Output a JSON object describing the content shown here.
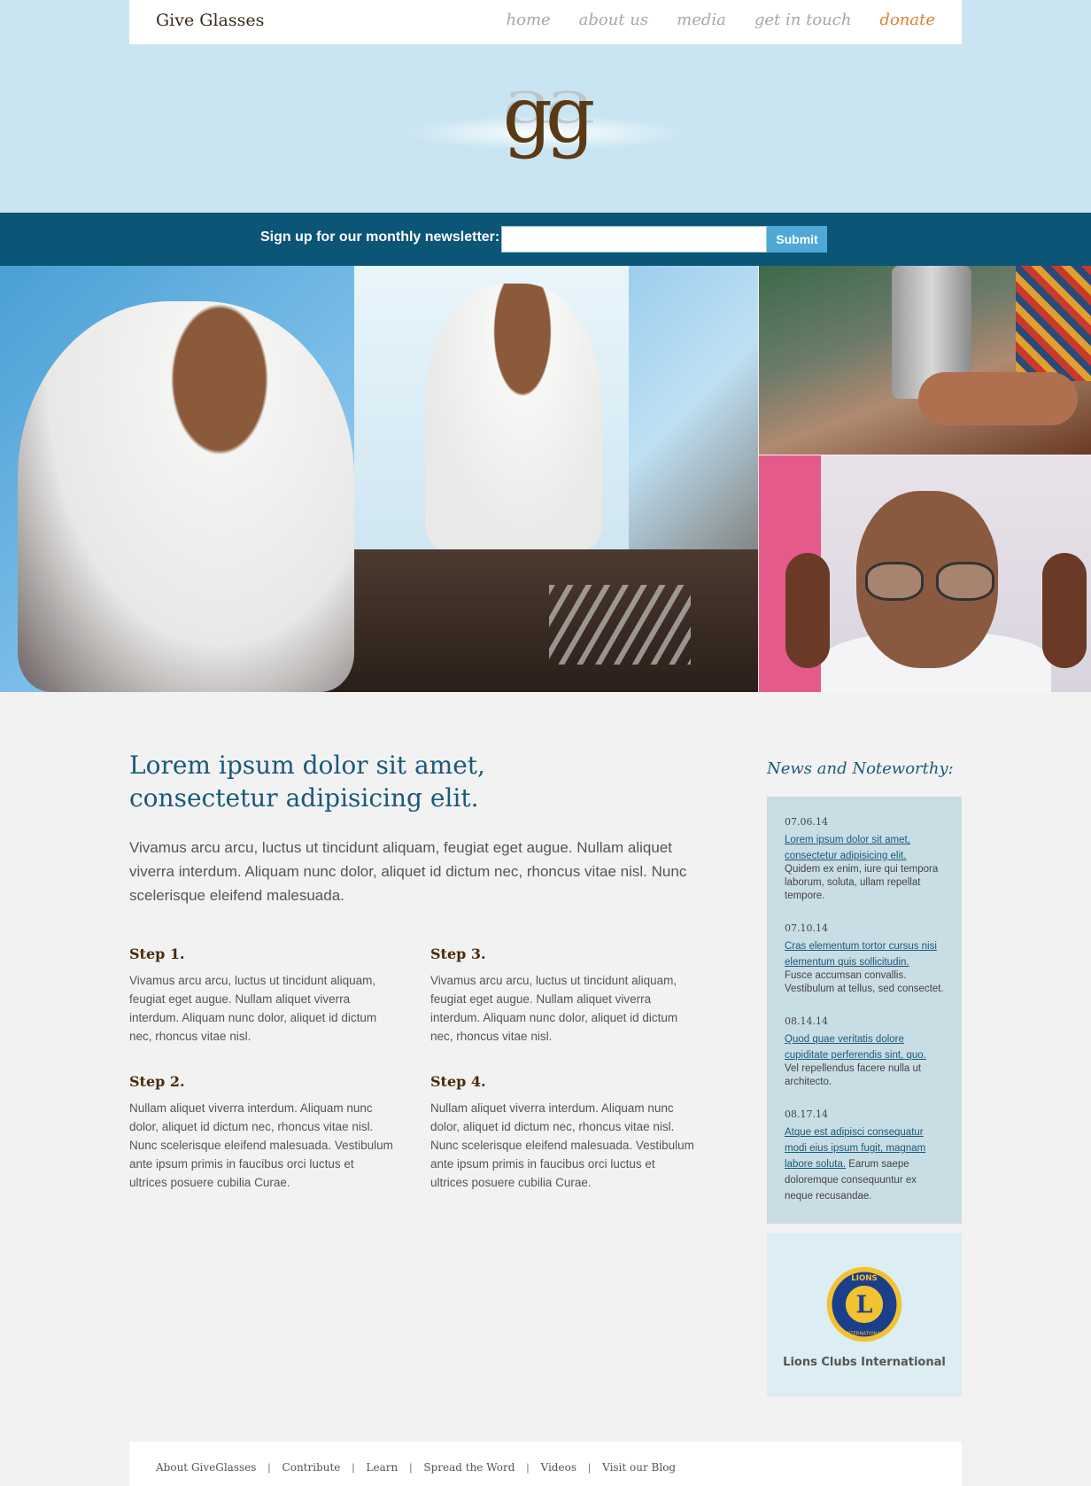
{
  "header": {
    "brand": "Give Glasses",
    "nav": [
      "home",
      "about us",
      "media",
      "get in touch",
      "donate"
    ],
    "logo_text": "gg"
  },
  "newsletter": {
    "label": "Sign up for our monthly newsletter:",
    "input_value": "",
    "submit": "Submit"
  },
  "main": {
    "headline_line1": "Lorem ipsum dolor sit amet,",
    "headline_line2": "consectetur adipisicing elit.",
    "lead": "Vivamus arcu arcu, luctus ut tincidunt aliquam, feugiat eget augue. Nullam aliquet viverra interdum. Aliquam nunc dolor, aliquet id dictum nec, rhoncus vitae nisl. Nunc scelerisque eleifend malesuada.",
    "steps": [
      {
        "title": "Step 1.",
        "text": "Vivamus arcu arcu, luctus ut tincidunt aliquam, feugiat eget augue. Nullam aliquet viverra interdum. Aliquam nunc dolor, aliquet id dictum nec, rhoncus vitae nisl."
      },
      {
        "title": "Step 2.",
        "text": "Nullam aliquet viverra interdum. Aliquam nunc dolor, aliquet id dictum nec, rhoncus vitae nisl. Nunc scelerisque eleifend malesuada. Vestibulum ante ipsum primis in faucibus orci luctus et ultrices posuere cubilia Curae."
      },
      {
        "title": "Step 3.",
        "text": "Vivamus arcu arcu, luctus ut tincidunt aliquam, feugiat eget augue. Nullam aliquet viverra interdum. Aliquam nunc dolor, aliquet id dictum nec, rhoncus vitae nisl."
      },
      {
        "title": "Step 4.",
        "text": "Nullam aliquet viverra interdum. Aliquam nunc dolor, aliquet id dictum nec, rhoncus vitae nisl. Nunc scelerisque eleifend malesuada. Vestibulum ante ipsum primis in faucibus orci luctus et ultrices posuere cubilia Curae."
      }
    ]
  },
  "sidebar": {
    "title": "News and Noteworthy:",
    "news": [
      {
        "date": "07.06.14",
        "link": "Lorem ipsum dolor sit amet, consectetur adipisicing elit.",
        "text": "Quidem ex enim, iure qui tempora laborum, soluta, ullam repellat tempore."
      },
      {
        "date": "07.10.14",
        "link": "Cras elementum tortor cursus nisi elementum quis sollicitudin.",
        "text": "Fusce accumsan convallis. Vestibulum at tellus, sed consectet."
      },
      {
        "date": "08.14.14",
        "link": "Quod quae veritatis dolore cupiditate perferendis sint, quo.",
        "text": "Vel repellendus facere nulla ut architecto."
      },
      {
        "date": "08.17.14",
        "link": "Atque est adipisci consequatur modi eius ipsum fugit, magnam labore soluta.",
        "text": " Earum saepe doloremque consequuntur ex neque recusandae."
      }
    ],
    "partner": {
      "name": "Lions Clubs International",
      "emblem_top": "LIONS",
      "emblem_letter": "L",
      "emblem_bottom": "INTERNATIONAL"
    }
  },
  "footer": {
    "links": [
      "About GiveGlasses",
      "Contribute",
      "Learn",
      "Spread the Word",
      "Videos",
      "Visit our Blog"
    ],
    "separator": "|"
  },
  "colors": {
    "header_band": "#c9e5f1",
    "newsletter_bar": "#0b5577",
    "accent_donate": "#e0802e",
    "headline": "#1a5a7a",
    "step_title": "#4a2a0e",
    "news_box": "#c9dde4"
  }
}
